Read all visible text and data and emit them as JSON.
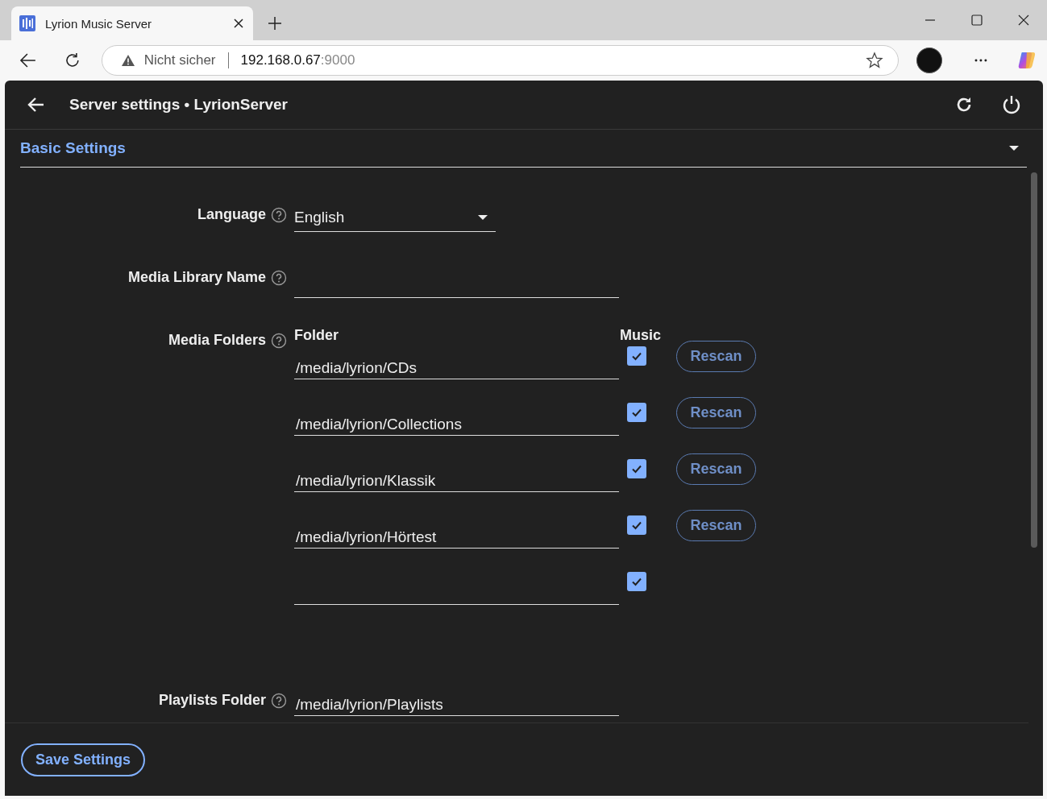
{
  "browser": {
    "tab_title": "Lyrion Music Server",
    "security": "Nicht sicher",
    "url_host": "192.168.0.67",
    "url_port": ":9000"
  },
  "app": {
    "title": "Server settings • LyrionServer"
  },
  "section": {
    "title": "Basic Settings",
    "expanded": true
  },
  "language": {
    "label": "Language",
    "value": "English"
  },
  "library_name": {
    "label": "Media Library Name"
  },
  "media_folders": {
    "label": "Media Folders",
    "columns": [
      "Folder",
      "Music"
    ],
    "rows": [
      {
        "path": "/media/lyrion/CDs",
        "music": true,
        "button": "Rescan"
      },
      {
        "path": "/media/lyrion/Collections",
        "music": true,
        "button": "Rescan"
      },
      {
        "path": "/media/lyrion/Klassik",
        "music": true,
        "button": "Rescan"
      },
      {
        "path": "/media/lyrion/Hörtest",
        "music": true,
        "button": "Rescan"
      },
      {
        "music": true
      }
    ]
  },
  "playlists": {
    "label": "Playlists Folder",
    "value": "/media/lyrion/Playlists"
  },
  "save_button": "Save Settings"
}
